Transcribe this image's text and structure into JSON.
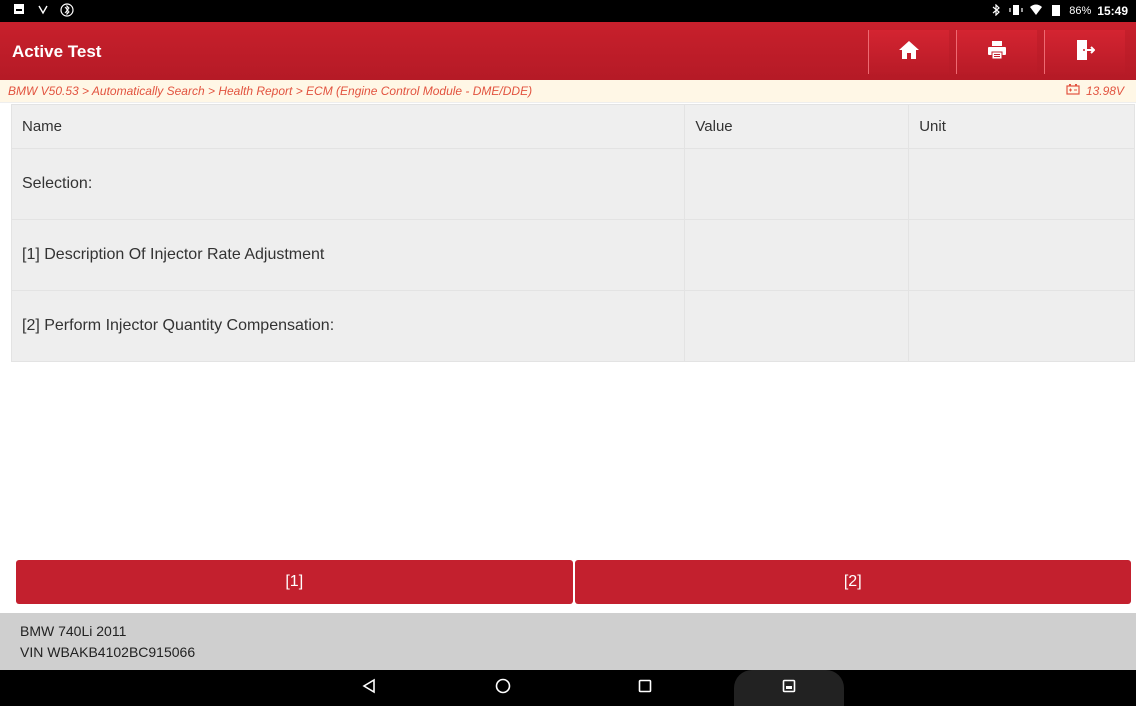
{
  "status": {
    "battery": "86%",
    "time": "15:49"
  },
  "header": {
    "title": "Active Test",
    "home_icon": "home-icon",
    "print_icon": "printer-icon",
    "exit_icon": "exit-icon"
  },
  "breadcrumb": {
    "path": "BMW V50.53 > Automatically Search > Health Report > ECM (Engine Control Module - DME/DDE)",
    "voltage": "13.98V"
  },
  "table": {
    "columns": [
      "Name",
      "Value",
      "Unit"
    ],
    "rows": [
      {
        "name": "Selection:",
        "value": "",
        "unit": ""
      },
      {
        "name": "[1] Description Of Injector Rate Adjustment",
        "value": "",
        "unit": ""
      },
      {
        "name": "[2] Perform Injector Quantity Compensation:",
        "value": "",
        "unit": ""
      }
    ]
  },
  "actions": {
    "button_1": "[1]",
    "button_2": "[2]"
  },
  "vehicle": {
    "model": "BMW 740Li 2011",
    "vin": "VIN WBAKB4102BC915066"
  },
  "colors": {
    "primary": "#c3202e",
    "breadcrumb_text": "#e2533f",
    "vehicle_bar": "#cfcfcf"
  }
}
